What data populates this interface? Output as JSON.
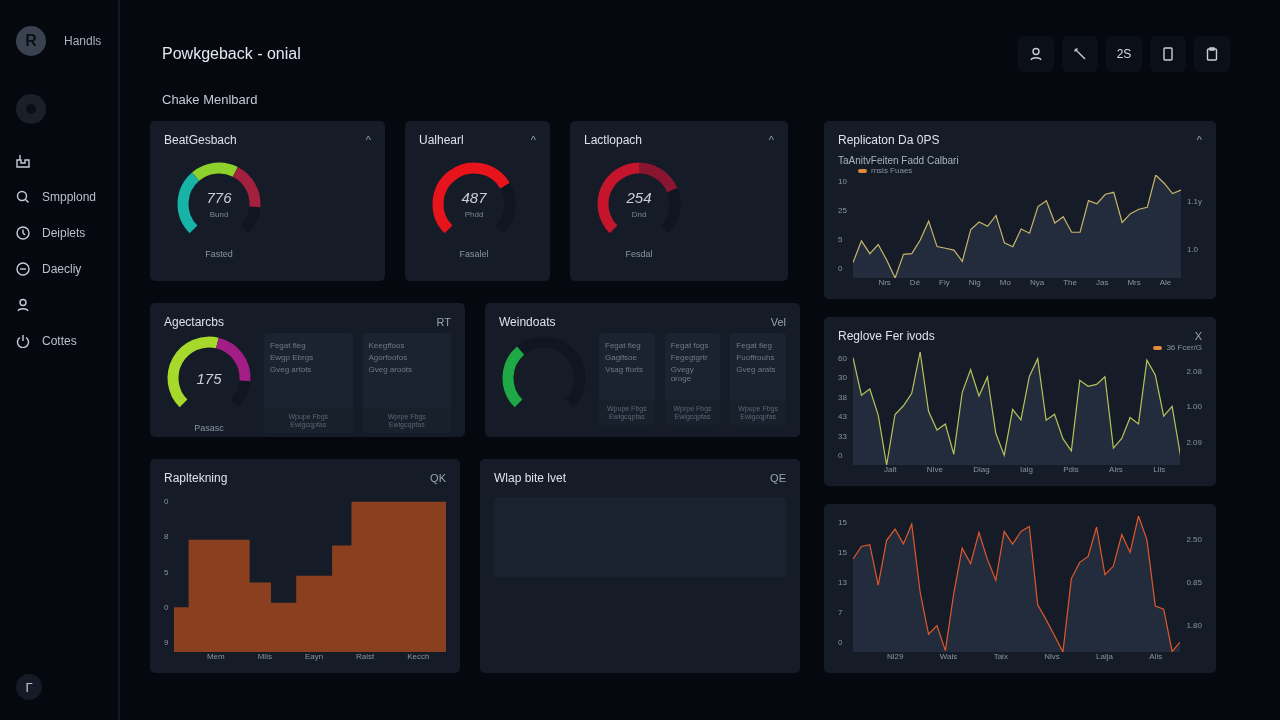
{
  "sidebar": {
    "brand": {
      "logo": "R",
      "name": "Handls"
    },
    "items": [
      {
        "kind": "icon"
      },
      {
        "kind": "link",
        "label": "Smpplond"
      },
      {
        "kind": "link",
        "label": "Deiplets"
      },
      {
        "kind": "link",
        "label": "Daecliy"
      },
      {
        "kind": "icon"
      },
      {
        "kind": "link",
        "label": "Cottes"
      }
    ],
    "footer": "Γ"
  },
  "header": {
    "title": "Powkgeback - onial",
    "tools": [
      {
        "kind": "icon"
      },
      {
        "kind": "icon"
      },
      {
        "kind": "text",
        "label": "2S"
      },
      {
        "kind": "icon"
      },
      {
        "kind": "icon"
      }
    ]
  },
  "subtitle": "Chake Menlbard",
  "gauge_cards": [
    {
      "title": "BeatGesbach",
      "action": "^",
      "value": "776",
      "unit": "Bund",
      "footer": "Fasted"
    },
    {
      "title": "Ualhearl",
      "action": "^",
      "value": "487",
      "unit": "Phdd",
      "footer": "Fasalel"
    },
    {
      "title": "Lactlopach",
      "action": "^",
      "value": "254",
      "unit": "Dnd",
      "footer": "Fesdal"
    }
  ],
  "panel_cards": [
    {
      "title": "Agectarcbs",
      "action": "RT",
      "gauge": {
        "value": "175",
        "label": "Pasasc"
      },
      "tiles": [
        {
          "lines": [
            "Fegat fleg",
            "Ewgp Ebrgs",
            "Gveg artots"
          ],
          "footer": [
            "Wpupe Fbgs",
            "Ewlgcqpfas"
          ]
        },
        {
          "lines": [
            "Keegffoos",
            "Agorfoofos",
            "Gveg aroots"
          ],
          "footer": [
            "Wprpe Fbgs",
            "Ewlgcqpfas"
          ]
        }
      ]
    },
    {
      "title": "Weindoats",
      "action": "Vel",
      "tiles": [
        {
          "lines": [
            "Fegat fieg",
            "Gaglfsoe",
            "Vsag fforts"
          ],
          "footer": [
            "Wpupe Fbgs",
            "Ewlgcqpfas"
          ]
        },
        {
          "lines": [
            "Fegat fogs",
            "Fegegtgrtr",
            "Gvegy oroge"
          ],
          "footer": [
            "Wprpe Fbgs",
            "Ewlgcqpfas"
          ]
        },
        {
          "lines": [
            "Fegat fieg",
            "Fuoffrouhs",
            "Gveg arats"
          ],
          "footer": [
            "Wpupe Fbgs",
            "Ewlgcqpfas"
          ]
        }
      ]
    }
  ],
  "bar_card": {
    "title": "Rapltekning",
    "action": "QK",
    "y_labels": [
      "0",
      "8",
      "5",
      "0",
      "9"
    ],
    "x_labels": [
      "Mem",
      "Mlis",
      "Eayn",
      "Raist",
      "Kecch"
    ]
  },
  "table_card": {
    "title": "Wlap bite lvet",
    "action": "QE"
  },
  "line_cards": [
    {
      "title": "Replicaton Da 0PS",
      "action": "^",
      "subtitle": "TaAnitvFeiten Fadd Calbari",
      "legend": "rnsis Fuaes",
      "y_labels": [
        "10",
        "25",
        "5",
        "0"
      ],
      "right_labels": [
        "1.1y",
        "1.0"
      ],
      "x_labels": [
        "Nrs",
        "Dé",
        "Fiy",
        "Nig",
        "Mo",
        "Nya",
        "The",
        "Jas",
        "Mrs",
        "Ale"
      ]
    },
    {
      "title": "Reglove Fer ivods",
      "action": "X",
      "legend": "36 Fcer/G",
      "y_labels": [
        "60",
        "30",
        "38",
        "43",
        "33",
        "0"
      ],
      "right_labels": [
        "2.08",
        "1.00",
        "2.09"
      ],
      "x_labels": [
        "Jalt",
        "Nlve",
        "Dlag",
        "Ialg",
        "Pdis",
        "Alrs",
        "Llis"
      ]
    },
    {
      "y_labels": [
        "15",
        "15",
        "13",
        "7",
        "0"
      ],
      "right_labels": [
        "2.50",
        "0.85",
        "1.80"
      ],
      "x_labels": [
        "Nl29",
        "Wals",
        "Talx",
        "Nlvs",
        "Lalja",
        "Alis"
      ]
    }
  ]
}
